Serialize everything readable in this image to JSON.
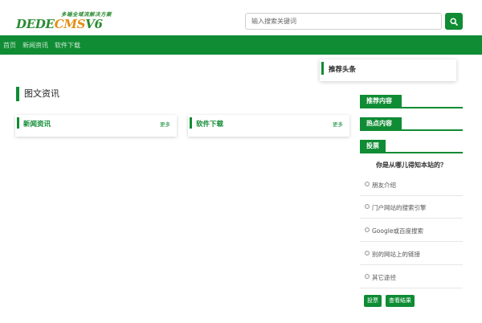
{
  "header": {
    "logo_slogan": "多端全域流解决方案",
    "logo_text_part1": "DEDE",
    "logo_text_part2": "C",
    "logo_text_part3": "MS",
    "logo_text_part4": "V6",
    "search_placeholder": "输入搜索关键词"
  },
  "nav": {
    "items": [
      {
        "label": "首页"
      },
      {
        "label": "新闻资讯"
      },
      {
        "label": "软件下载"
      }
    ]
  },
  "main": {
    "section_title": "图文资讯",
    "boxes": [
      {
        "title": "新闻资讯",
        "more": "更多"
      },
      {
        "title": "软件下载",
        "more": "更多"
      }
    ]
  },
  "sidebar": {
    "headline_title": "推荐头条",
    "recommend_title": "推荐内容",
    "hot_title": "热点内容",
    "vote_title": "投票",
    "vote_question": "你是从哪儿得知本站的？",
    "vote_options": [
      {
        "label": "朋友介绍"
      },
      {
        "label": "门户网站的搜索引擎"
      },
      {
        "label": "Google或百度搜索"
      },
      {
        "label": "别的网站上的链接"
      },
      {
        "label": "其它途径"
      }
    ],
    "vote_button": "投票",
    "results_button": "查看结果"
  },
  "colors": {
    "brand_green": "#0f8c34",
    "logo_orange": "#e38e15"
  }
}
